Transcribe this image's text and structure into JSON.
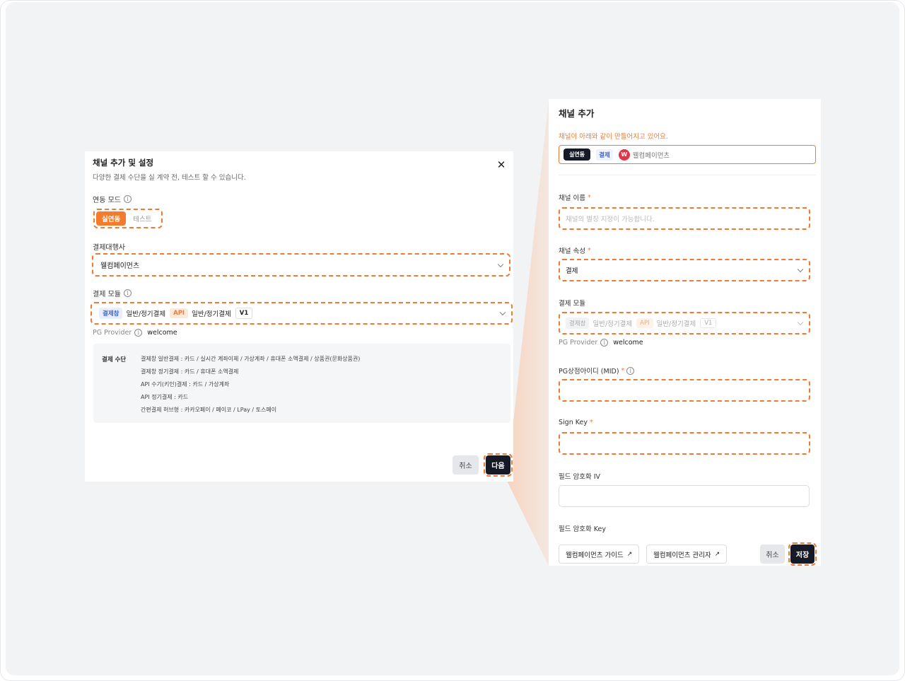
{
  "left_modal": {
    "title": "채널 추가 및 설정",
    "subtitle": "다양한 결제 수단을 실 계약 전, 테스트 할 수 있습니다.",
    "close_icon": "close-icon",
    "link_mode": {
      "label": "연동 모드",
      "options": [
        "실연동",
        "테스트"
      ],
      "selected": "실연동"
    },
    "pg": {
      "label": "결제대행사",
      "value": "웰컴페이먼츠"
    },
    "module": {
      "label": "결제 모듈",
      "tag1": "결제창",
      "tag1_text": "일반/정기결제",
      "tag2": "API",
      "tag2_text": "일반/정기결제",
      "version": "V1"
    },
    "pg_provider": {
      "label": "PG Provider",
      "value": "welcome"
    },
    "methods": {
      "label": "결제 수단",
      "lines": [
        "결제창 일반결제 : 카드 / 실시간 계좌이체 / 가상계좌 / 휴대폰 소액결제 / 상품권(문화상품권)",
        "결제창 정기결제 : 카드 / 휴대폰 소액결제",
        "API 수기(키인)결제 : 카드 / 가상계좌",
        "API 정기결제 : 카드",
        "간편결제 허브형 : 카카오페이 / 페이코 / LPay / 토스페이"
      ]
    },
    "cancel_label": "취소",
    "next_label": "다음"
  },
  "right_panel": {
    "title": "채널 추가",
    "hint": "채널이 아래와 같이 만들어지고 있어요.",
    "summary": {
      "mode": "실연동",
      "attr": "결제",
      "logo_glyph": "W",
      "pg_name": "웰컴페이먼츠"
    },
    "channel_name": {
      "label": "채널 이름",
      "required": "*",
      "placeholder": "채널의 별칭 지정이 가능합니다."
    },
    "channel_attr": {
      "label": "채널 속성",
      "required": "*",
      "value": "결제"
    },
    "module": {
      "label": "결제 모듈",
      "tag1": "결제창",
      "tag1_text": "일반/정기결제",
      "tag2": "API",
      "tag2_text": "일반/정기결제",
      "version": "V1"
    },
    "pg_provider": {
      "label": "PG Provider",
      "value": "welcome"
    },
    "mid": {
      "label": "PG상점아이디 (MID)",
      "required": "*"
    },
    "sign_key": {
      "label": "Sign Key",
      "required": "*"
    },
    "field_iv": {
      "label": "필드 암호화 IV"
    },
    "field_key": {
      "label": "필드 암호화 Key"
    },
    "guide_label": "웰컴페이먼츠 가이드",
    "admin_label": "웰컴페이먼츠 관리자",
    "cancel_label": "취소",
    "save_label": "저장"
  },
  "colors": {
    "accent": "#f07a33",
    "dark_button": "#161a26",
    "background": "#f2f3f5"
  }
}
